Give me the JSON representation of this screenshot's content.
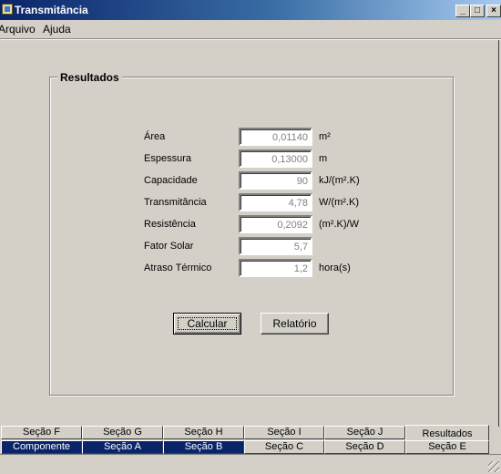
{
  "window": {
    "title": "Transmitância",
    "minimize": "_",
    "maximize": "□",
    "close": "×"
  },
  "menu": {
    "file": "Arquivo",
    "help": "Ajuda"
  },
  "group": {
    "title": "Resultados"
  },
  "fields": [
    {
      "label": "Área",
      "value": "0,01140",
      "unit": "m²"
    },
    {
      "label": "Espessura",
      "value": "0,13000",
      "unit": "m"
    },
    {
      "label": "Capacidade",
      "value": "90",
      "unit": "kJ/(m².K)"
    },
    {
      "label": "Transmitância",
      "value": "4,78",
      "unit": "W/(m².K)"
    },
    {
      "label": "Resistência",
      "value": "0,2092",
      "unit": "(m².K)/W"
    },
    {
      "label": "Fator Solar",
      "value": "5,7",
      "unit": ""
    },
    {
      "label": "Atraso Térmico",
      "value": "1,2",
      "unit": "hora(s)"
    }
  ],
  "buttons": {
    "calc": "Calcular",
    "report": "Relatório"
  },
  "tabs_top": [
    "Seção F",
    "Seção G",
    "Seção H",
    "Seção I",
    "Seção J",
    "Resultados"
  ],
  "tabs_bottom": [
    "Componente",
    "Seção A",
    "Seção B",
    "Seção C",
    "Seção D",
    "Seção E"
  ]
}
